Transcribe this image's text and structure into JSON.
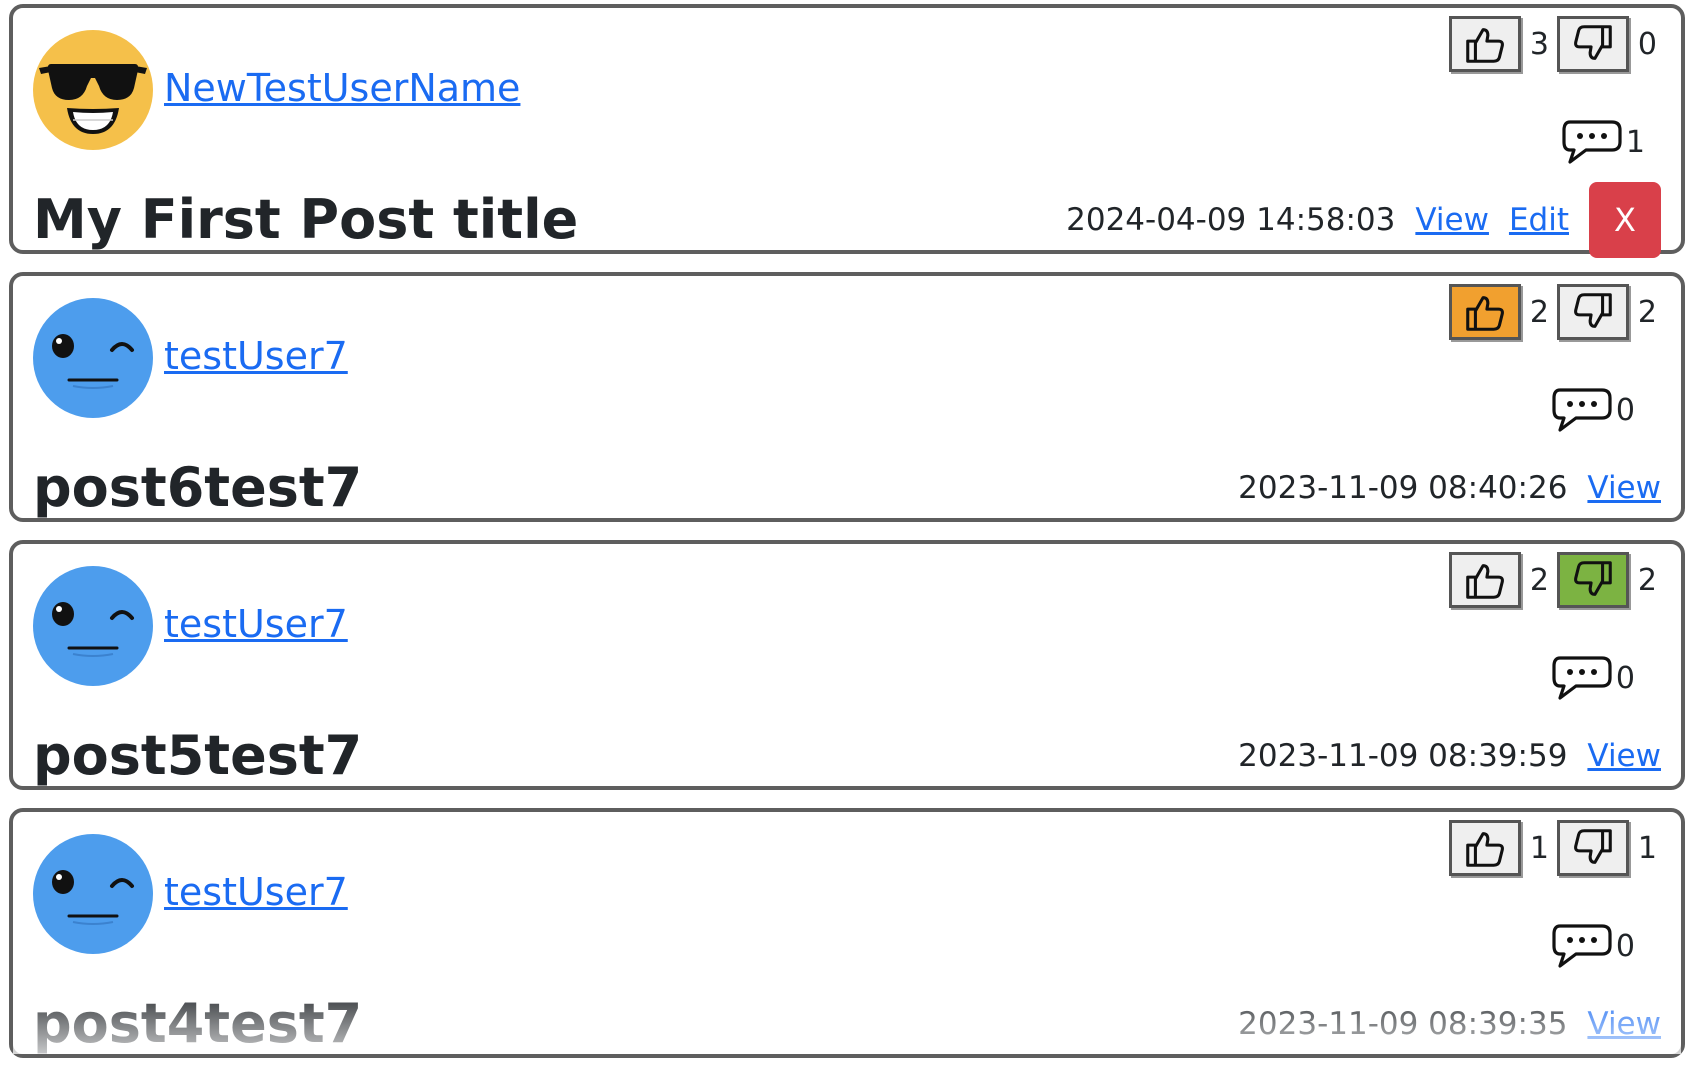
{
  "posts": [
    {
      "username": "NewTestUserName",
      "avatar": "sunglasses-face-icon",
      "title": "My First Post title",
      "likes": "3",
      "dislikes": "0",
      "vote_state": "none",
      "comments": "1",
      "timestamp": "2024-04-09 14:58:03",
      "view_label": "View",
      "edit_label": "Edit",
      "delete_label": "X"
    },
    {
      "username": "testUser7",
      "avatar": "winking-face-icon",
      "title": "post6test7",
      "likes": "2",
      "dislikes": "2",
      "vote_state": "liked",
      "comments": "0",
      "timestamp": "2023-11-09 08:40:26",
      "view_label": "View"
    },
    {
      "username": "testUser7",
      "avatar": "winking-face-icon",
      "title": "post5test7",
      "likes": "2",
      "dislikes": "2",
      "vote_state": "disliked",
      "comments": "0",
      "timestamp": "2023-11-09 08:39:59",
      "view_label": "View"
    },
    {
      "username": "testUser7",
      "avatar": "winking-face-icon",
      "title": "post4test7",
      "likes": "1",
      "dislikes": "1",
      "vote_state": "none",
      "comments": "0",
      "timestamp": "2023-11-09 08:39:35",
      "view_label": "View"
    }
  ],
  "colors": {
    "link": "#1a6bf2",
    "liked": "#f1a02f",
    "disliked": "#7cb342",
    "delete": "#d9404a",
    "card_border": "#5e5e5e"
  }
}
